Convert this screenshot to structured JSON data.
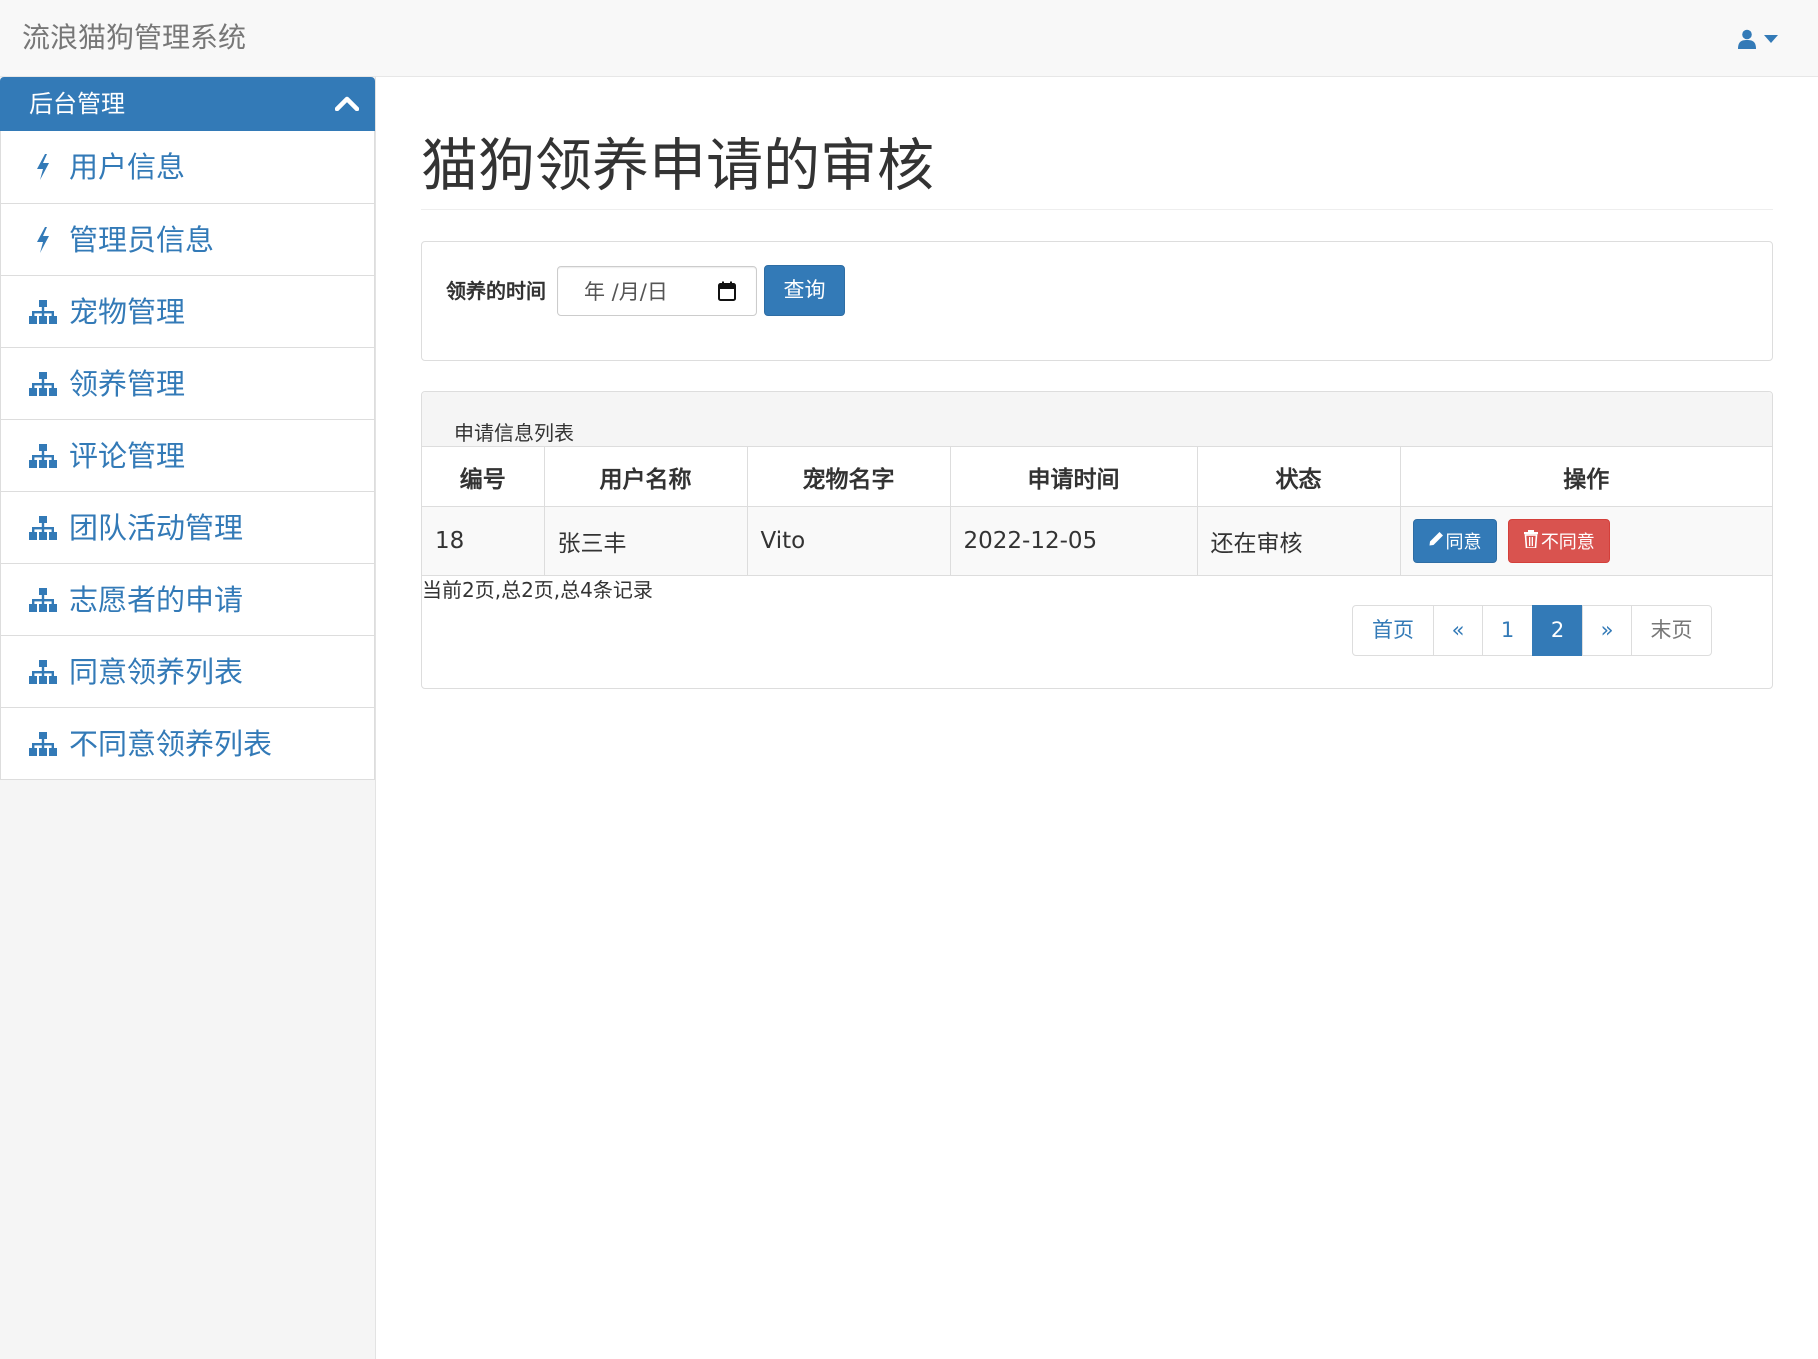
{
  "app": {
    "title": "流浪猫狗管理系统"
  },
  "sidebar": {
    "header": "后台管理",
    "items": [
      {
        "label": "用户信息",
        "icon": "bolt-icon"
      },
      {
        "label": "管理员信息",
        "icon": "bolt-icon"
      },
      {
        "label": "宠物管理",
        "icon": "sitemap-icon"
      },
      {
        "label": "领养管理",
        "icon": "sitemap-icon"
      },
      {
        "label": "评论管理",
        "icon": "sitemap-icon"
      },
      {
        "label": "团队活动管理",
        "icon": "sitemap-icon"
      },
      {
        "label": "志愿者的申请",
        "icon": "sitemap-icon"
      },
      {
        "label": "同意领养列表",
        "icon": "sitemap-icon"
      },
      {
        "label": "不同意领养列表",
        "icon": "sitemap-icon"
      }
    ]
  },
  "main": {
    "page_title": "猫狗领养申请的审核",
    "search": {
      "label": "领养的时间",
      "date_placeholder": "年 /月/日",
      "button": "查询"
    },
    "list": {
      "title": "申请信息列表",
      "columns": [
        "编号",
        "用户名称",
        "宠物名字",
        "申请时间",
        "状态",
        "操作"
      ],
      "rows": [
        {
          "id": "18",
          "user": "张三丰",
          "pet": "Vito",
          "date": "2022-12-05",
          "status": "还在审核",
          "approve": "同意",
          "reject": "不同意"
        }
      ],
      "page_info": "当前2页,总2页,总4条记录",
      "pagination": {
        "first": "首页",
        "prev": "«",
        "pages": [
          "1",
          "2"
        ],
        "current": "2",
        "next": "»",
        "last": "末页"
      }
    }
  },
  "colors": {
    "primary": "#337ab7",
    "danger": "#d9534f",
    "navbar_bg": "#f8f8f8"
  }
}
